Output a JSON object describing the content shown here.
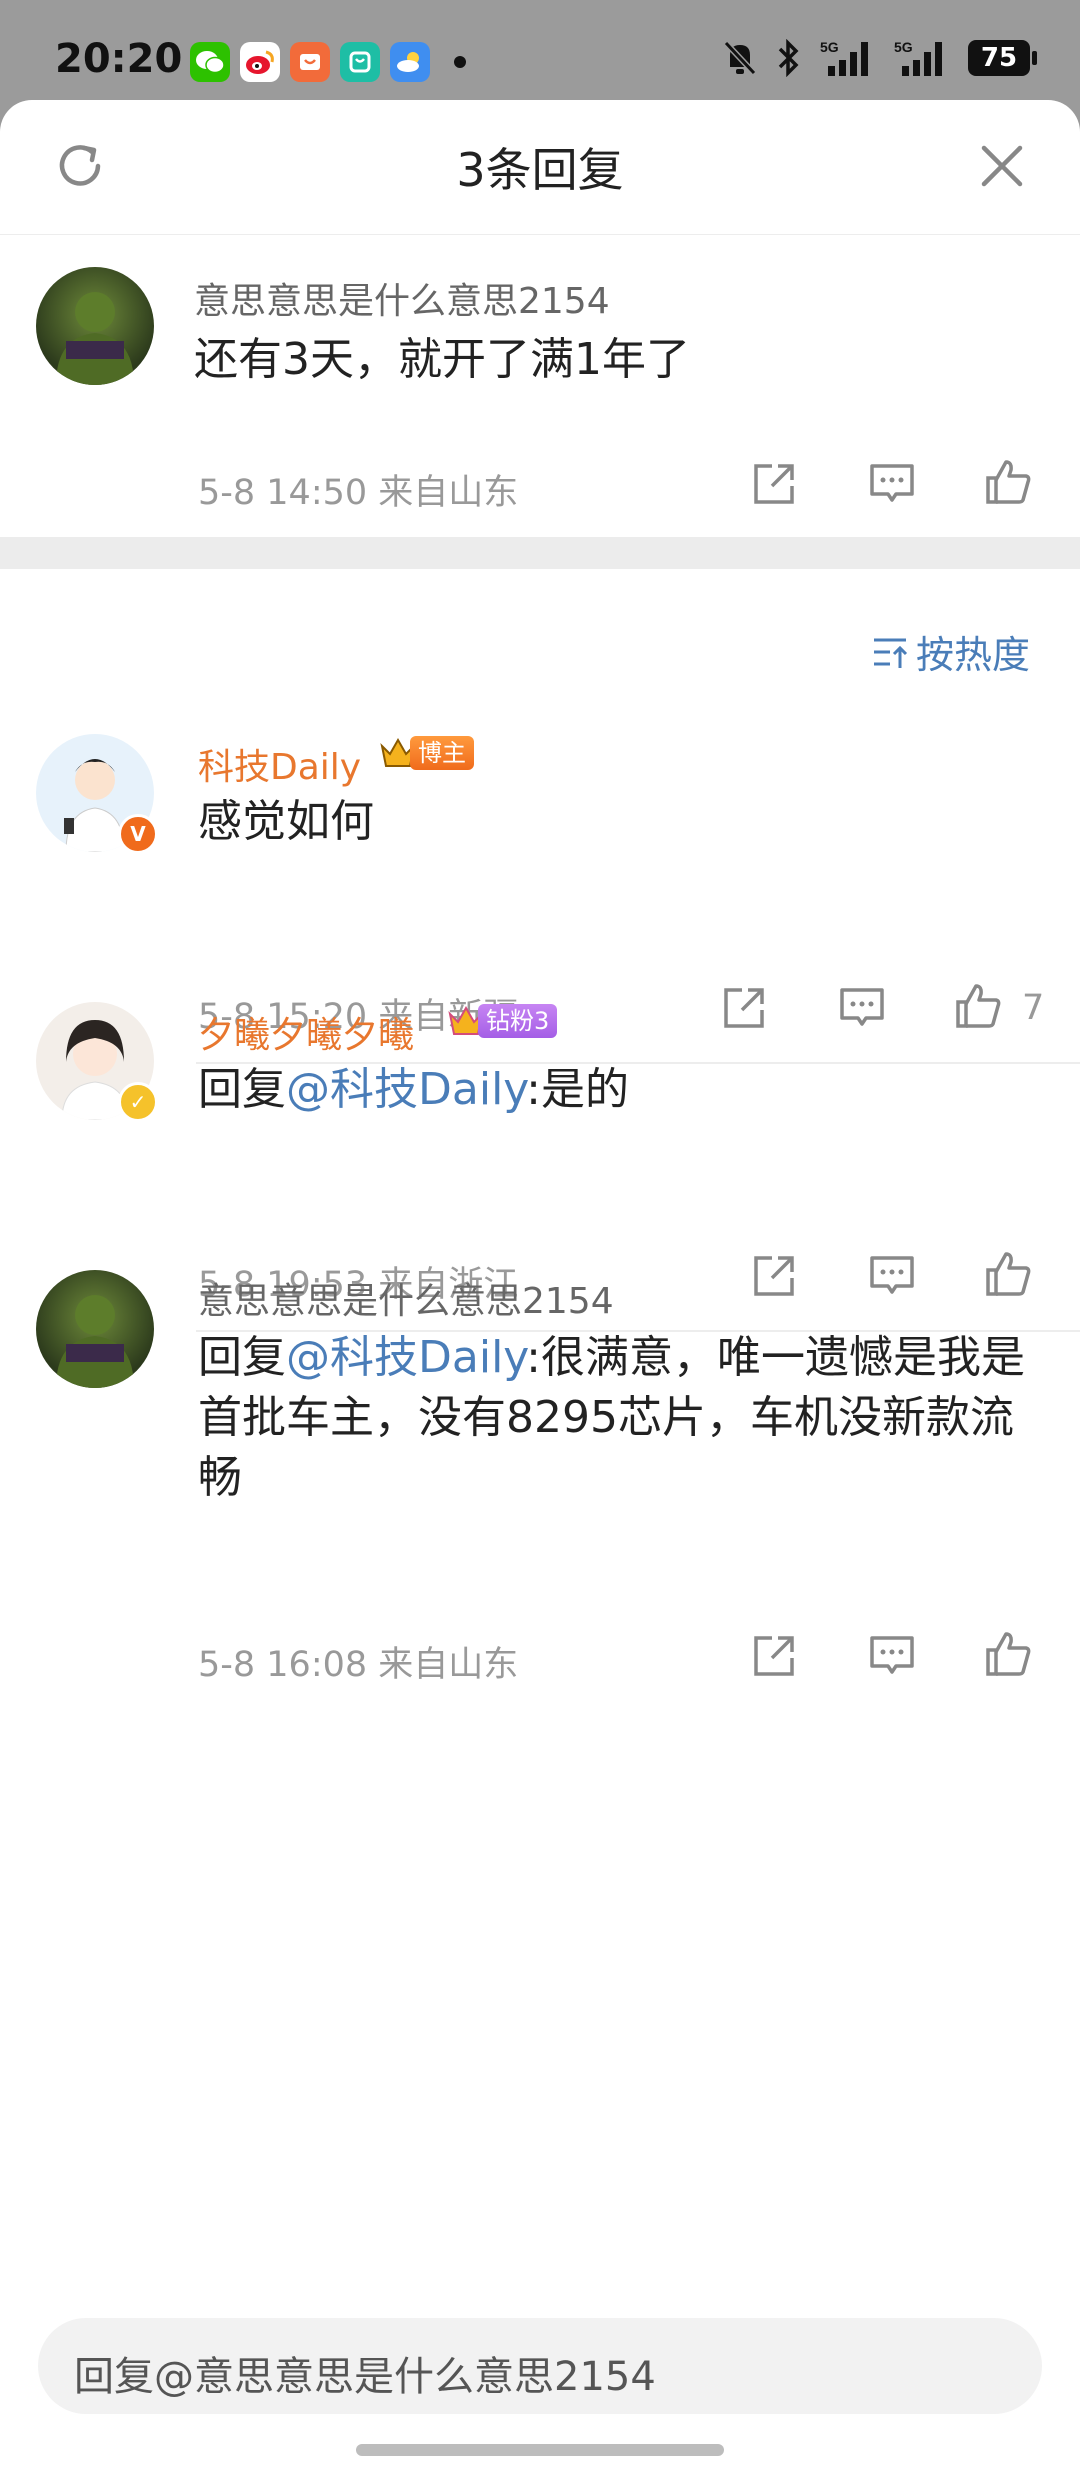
{
  "status_bar": {
    "time": "20:20",
    "battery": "75",
    "signal_label": "5G"
  },
  "header": {
    "title": "3条回复"
  },
  "root_comment": {
    "username": "意思意思是什么意思2154",
    "content": "还有3天，就开了满1年了",
    "meta": "5-8 14:50  来自山东"
  },
  "sort": {
    "label": "按热度"
  },
  "replies": [
    {
      "username": "科技Daily",
      "tag": "博主",
      "content": "感觉如何",
      "meta": "5-8 15:20  来自新疆",
      "likes": "7"
    },
    {
      "username": "夕曦夕曦夕曦",
      "tag": "钻粉3",
      "prefix": "回复",
      "mention": "@科技Daily",
      "content": ":是的",
      "meta": "5-8 19:53  来自浙江"
    },
    {
      "username": "意思意思是什么意思2154",
      "prefix": "回复",
      "mention": "@科技Daily",
      "content": ":很满意，唯一遗憾是我是首批车主，没有8295芯片，车机没新款流畅",
      "meta": "5-8 16:08  来自山东"
    }
  ],
  "reply_input": {
    "placeholder": "回复@意思意思是什么意思2154"
  }
}
